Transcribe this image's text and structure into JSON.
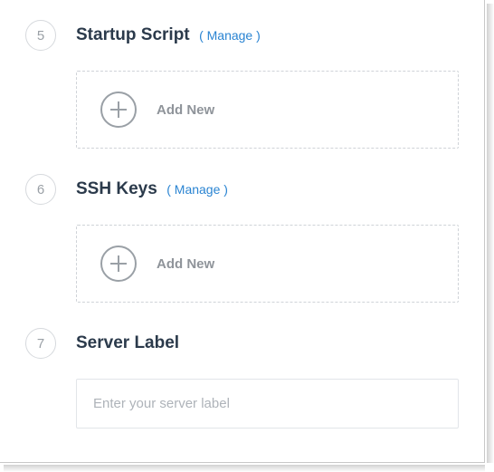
{
  "sections": {
    "startup_script": {
      "step": "5",
      "title": "Startup Script",
      "manage": "( Manage )",
      "add_label": "Add New"
    },
    "ssh_keys": {
      "step": "6",
      "title": "SSH Keys",
      "manage": "( Manage )",
      "add_label": "Add New"
    },
    "server_label": {
      "step": "7",
      "title": "Server Label",
      "placeholder": "Enter your server label"
    }
  }
}
